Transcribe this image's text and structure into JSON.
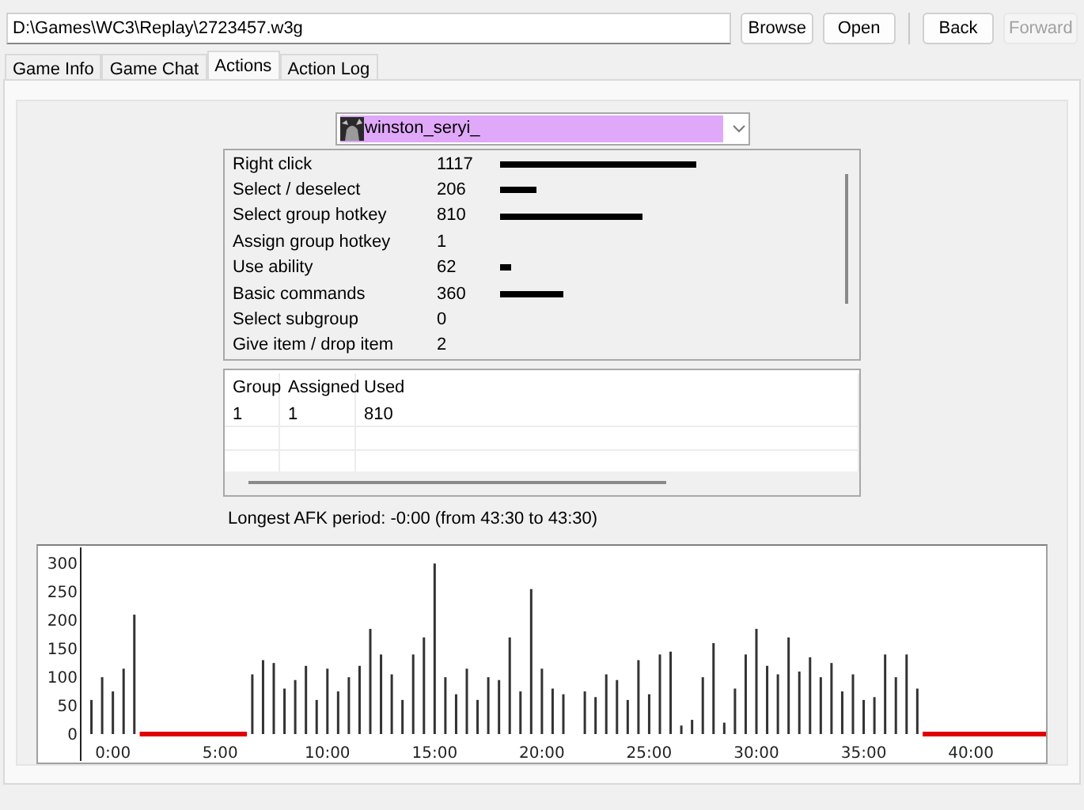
{
  "path_field": {
    "value": "D:\\Games\\WC3\\Replay\\2723457.w3g"
  },
  "buttons": [
    {
      "label": "Browse",
      "disabled": false
    },
    {
      "label": "Open",
      "disabled": false
    },
    {
      "label": "Back",
      "disabled": false
    },
    {
      "label": "Forward",
      "disabled": true
    }
  ],
  "tabs": [
    {
      "label": "Game Info",
      "selected": false
    },
    {
      "label": "Game Chat",
      "selected": false
    },
    {
      "label": "Actions",
      "selected": true
    },
    {
      "label": "Action Log",
      "selected": false
    }
  ],
  "player_select": {
    "value": "winston_seryi_",
    "color": "#e0a8f8"
  },
  "actions": [
    {
      "name": "Right click",
      "count": "1117"
    },
    {
      "name": "Select / deselect",
      "count": "206"
    },
    {
      "name": "Select group hotkey",
      "count": "810"
    },
    {
      "name": "Assign group hotkey",
      "count": "1"
    },
    {
      "name": "Use ability",
      "count": "62"
    },
    {
      "name": "Basic commands",
      "count": "360"
    },
    {
      "name": "Select subgroup",
      "count": "0"
    },
    {
      "name": "Give item / drop item",
      "count": "2"
    }
  ],
  "groups_table": {
    "columns": [
      "Group",
      "Assigned",
      "Used"
    ],
    "rows": [
      [
        "1",
        "1",
        "810"
      ]
    ]
  },
  "afk_text": "Longest AFK period: -0:00 (from 43:30 to 43:30)",
  "chart_data": {
    "type": "bar",
    "x": [
      -1,
      -0.5,
      0,
      0.5,
      1,
      1.5,
      2,
      2.5,
      3,
      3.5,
      4,
      4.5,
      5,
      5.5,
      6,
      6.5,
      7,
      7.5,
      8,
      8.5,
      9,
      9.5,
      10,
      10.5,
      11,
      11.5,
      12,
      12.5,
      13,
      13.5,
      14,
      14.5,
      15,
      15.5,
      16,
      16.5,
      17,
      17.5,
      18,
      18.5,
      19,
      19.5,
      20,
      20.5,
      21,
      21.5,
      22,
      22.5,
      23,
      23.5,
      24,
      24.5,
      25,
      25.5,
      26,
      26.5,
      27,
      27.5,
      28,
      28.5,
      29,
      29.5,
      30,
      30.5,
      31,
      31.5,
      32,
      32.5,
      33,
      33.5,
      34,
      34.5,
      35,
      35.5,
      36,
      36.5,
      37,
      37.5,
      38,
      38.5,
      39,
      39.5,
      40,
      40.5,
      41,
      41.5,
      42,
      42.5,
      43
    ],
    "series": [
      {
        "color": "#333333",
        "values": [
          60,
          100,
          75,
          115,
          210,
          null,
          null,
          null,
          null,
          null,
          null,
          null,
          null,
          null,
          null,
          105,
          130,
          125,
          80,
          95,
          120,
          60,
          115,
          75,
          100,
          120,
          185,
          140,
          105,
          60,
          140,
          170,
          300,
          100,
          70,
          115,
          60,
          100,
          95,
          170,
          75,
          255,
          115,
          80,
          70,
          null,
          75,
          65,
          105,
          95,
          60,
          130,
          70,
          140,
          145,
          15,
          25,
          100,
          160,
          20,
          80,
          140,
          185,
          120,
          105,
          170,
          110,
          135,
          100,
          125,
          75,
          105,
          60,
          65,
          140,
          100,
          140,
          80,
          null,
          null,
          null,
          null,
          null,
          null,
          null,
          null,
          null,
          null,
          null
        ]
      },
      {
        "color": "#e00000",
        "values": [
          null,
          null,
          null,
          null,
          null,
          0,
          0,
          0,
          0,
          0,
          0,
          0,
          0,
          0,
          0,
          null,
          null,
          null,
          null,
          null,
          null,
          null,
          null,
          null,
          null,
          null,
          null,
          null,
          null,
          null,
          null,
          null,
          null,
          null,
          null,
          null,
          null,
          null,
          null,
          null,
          null,
          null,
          null,
          null,
          null,
          null,
          null,
          null,
          null,
          null,
          null,
          null,
          null,
          null,
          null,
          null,
          null,
          null,
          null,
          null,
          null,
          null,
          null,
          null,
          null,
          null,
          null,
          null,
          null,
          null,
          null,
          null,
          null,
          null,
          null,
          null,
          null,
          null,
          0,
          0,
          0,
          0,
          0,
          0,
          0,
          0,
          0,
          0,
          0
        ]
      }
    ],
    "xlim": [
      -1.5,
      43.5
    ],
    "ylim": [
      0,
      320
    ],
    "xticks": [
      {
        "value": 0,
        "label": "0:00"
      },
      {
        "value": 5,
        "label": "5:00"
      },
      {
        "value": 10,
        "label": "10:00"
      },
      {
        "value": 15,
        "label": "15:00"
      },
      {
        "value": 20,
        "label": "20:00"
      },
      {
        "value": 25,
        "label": "25:00"
      },
      {
        "value": 30,
        "label": "30:00"
      },
      {
        "value": 35,
        "label": "35:00"
      },
      {
        "value": 40,
        "label": "40:00"
      }
    ],
    "yticks": [
      0,
      50,
      100,
      150,
      200,
      250,
      300
    ]
  }
}
